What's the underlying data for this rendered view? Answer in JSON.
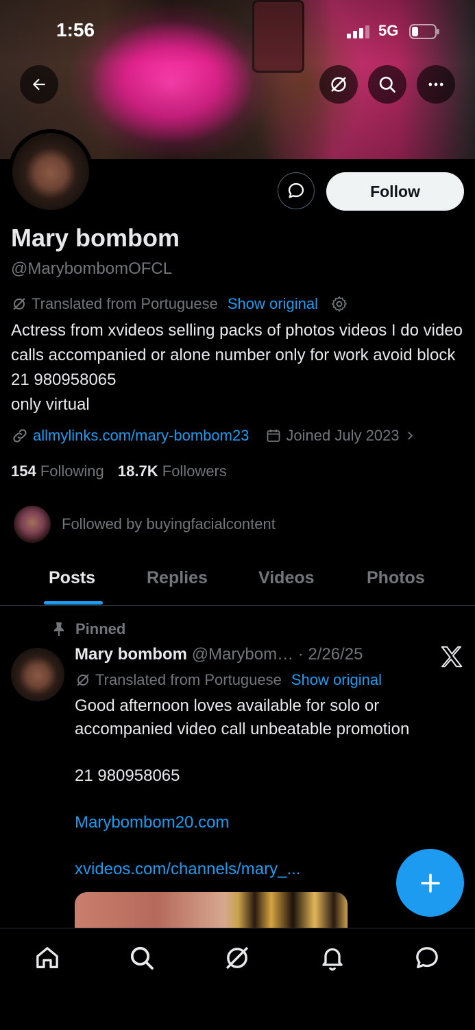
{
  "status_bar": {
    "time": "1:56",
    "network": "5G"
  },
  "profile": {
    "name": "Mary bombom",
    "handle": "@MarybombomOFCL",
    "translated_label": "Translated from Portuguese",
    "show_original": "Show original",
    "bio": "Actress from xvideos selling packs of photos videos I do video calls accompanied or alone number only for work avoid block 21 980958065\nonly virtual",
    "website": "allmylinks.com/mary-bombom23",
    "joined": "Joined July 2023",
    "following_count": "154",
    "following_label": "Following",
    "followers_count": "18.7K",
    "followers_label": "Followers",
    "followed_by": "Followed by buyingfacialcontent",
    "follow_label": "Follow"
  },
  "tabs": [
    {
      "label": "Posts",
      "active": true
    },
    {
      "label": "Replies"
    },
    {
      "label": "Videos"
    },
    {
      "label": "Photos"
    }
  ],
  "post": {
    "pinned_label": "Pinned",
    "author": "Mary bombom",
    "handle_date": "@Marybom… · 2/26/25",
    "translated_label": "Translated from Portuguese",
    "show_original": "Show original",
    "text_line1": "Good afternoon loves available for solo or accompanied video call unbeatable promotion",
    "text_phone": "21 980958065",
    "link1": "Marybombom20.com",
    "link2": "xvideos.com/channels/mary_..."
  },
  "colors": {
    "accent": "#1d9bf0",
    "background": "#000000",
    "muted": "#71767b"
  }
}
